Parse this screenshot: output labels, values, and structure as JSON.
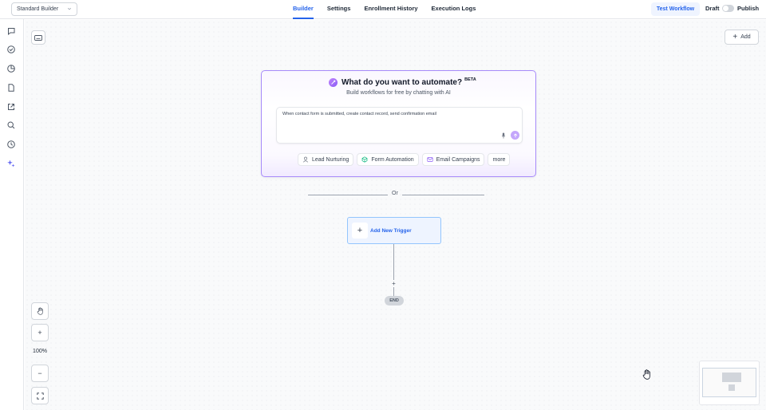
{
  "header": {
    "builder_select": "Standard Builder",
    "tabs": [
      {
        "label": "Builder",
        "active": true
      },
      {
        "label": "Settings",
        "active": false
      },
      {
        "label": "Enrollment History",
        "active": false
      },
      {
        "label": "Execution Logs",
        "active": false
      }
    ],
    "test_workflow": "Test Workflow",
    "draft": "Draft",
    "publish": "Publish"
  },
  "sidebar": {
    "icons": [
      "chat-icon",
      "check-circle-icon",
      "pie-chart-icon",
      "document-icon",
      "external-link-icon",
      "search-icon",
      "history-icon",
      "sparkles-icon"
    ]
  },
  "canvas": {
    "add_button": "Add"
  },
  "ai_card": {
    "title": "What do you want to automate?",
    "badge": "BETA",
    "subtitle": "Build workflows for free by chatting with AI",
    "prompt_text": "When contact form is submitted, create contact record, send confirmation email",
    "chips": [
      {
        "label": "Lead Nurturing",
        "icon": "user-icon"
      },
      {
        "label": "Form Automation",
        "icon": "cube-icon"
      },
      {
        "label": "Email Campaigns",
        "icon": "mail-icon"
      },
      {
        "label": "more",
        "icon": ""
      }
    ]
  },
  "divider": {
    "text": "Or"
  },
  "flow": {
    "trigger_label": "Add New Trigger",
    "add_step": "+",
    "end_label": "END"
  },
  "controls": {
    "zoom_in": "+",
    "zoom_level": "100%",
    "zoom_out": "−"
  },
  "colors": {
    "accent": "#2563eb",
    "ai_purple": "#8b5cf6"
  }
}
